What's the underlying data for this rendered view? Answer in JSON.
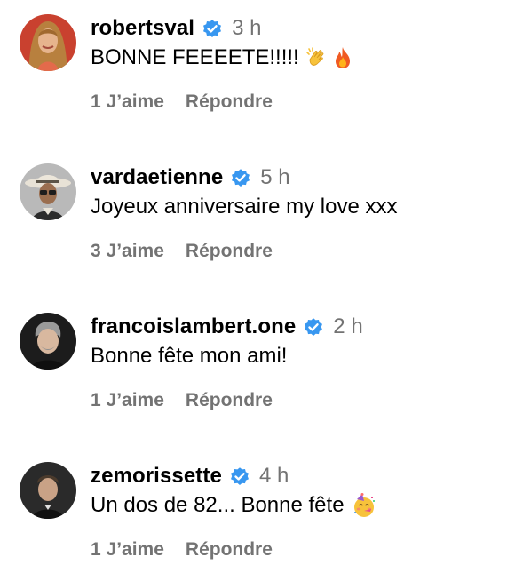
{
  "comments": [
    {
      "username": "robertsval",
      "time": "3 h",
      "text": "BONNE FEEEETE!!!!!",
      "emojis": [
        "clapping-hands-icon",
        "fire-icon"
      ],
      "likes": "1 J’aime",
      "reply": "Répondre"
    },
    {
      "username": "vardaetienne",
      "time": "5 h",
      "text": "Joyeux anniversaire my love xxx",
      "emojis": [],
      "likes": "3 J’aime",
      "reply": "Répondre"
    },
    {
      "username": "francoislambert.one",
      "time": "2 h",
      "text": "Bonne fête mon ami!",
      "emojis": [],
      "likes": "1 J’aime",
      "reply": "Répondre"
    },
    {
      "username": "zemorissette",
      "time": "4 h",
      "text": "Un dos de 82... Bonne fête",
      "emojis": [
        "partying-face-icon"
      ],
      "likes": "1 J’aime",
      "reply": "Répondre"
    }
  ],
  "colors": {
    "verified": "#3897f0",
    "secondary_text": "#737373",
    "primary_text": "#000000"
  }
}
